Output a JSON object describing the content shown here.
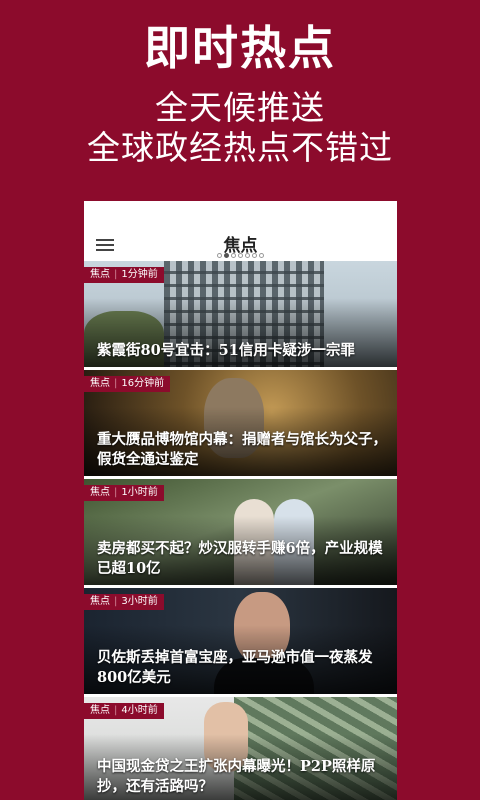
{
  "promo": {
    "title": "即时热点",
    "subtitle_line1": "全天候推送",
    "subtitle_line2": "全球政经热点不错过"
  },
  "app": {
    "title": "焦点",
    "menu_icon": "hamburger-menu-icon",
    "page_indicator": {
      "total": 7,
      "active": 1
    }
  },
  "theme": {
    "brand": "#8c0b2c"
  },
  "articles": [
    {
      "tag": "焦点",
      "time": "1分钟前",
      "headline": "紫霞街80号宜击：51信用卡疑涉一宗罪"
    },
    {
      "tag": "焦点",
      "time": "16分钟前",
      "headline": "重大赝品博物馆内幕：捐赠者与馆长为父子，假货全通过鉴定"
    },
    {
      "tag": "焦点",
      "time": "1小时前",
      "headline": "卖房都买不起？炒汉服转手赚6倍，产业规模已超10亿"
    },
    {
      "tag": "焦点",
      "time": "3小时前",
      "headline": "贝佐斯丢掉首富宝座，亚马逊市值一夜蒸发800亿美元"
    },
    {
      "tag": "焦点",
      "time": "4小时前",
      "headline": "中国现金贷之王扩张内幕曝光！P2P照样原抄，还有活路吗？"
    }
  ]
}
